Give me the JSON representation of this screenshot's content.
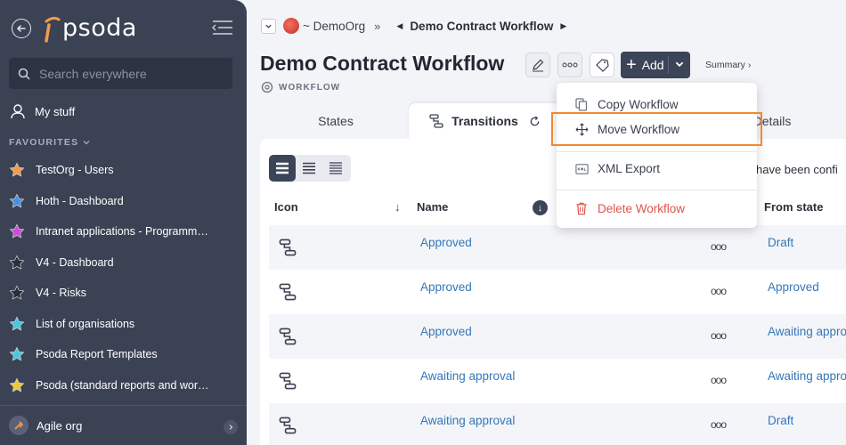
{
  "sidebar": {
    "logo_text": "psoda",
    "search_placeholder": "Search everywhere",
    "my_stuff": "My stuff",
    "favourites_header": "FAVOURITES",
    "favourites": [
      {
        "label": "TestOrg - Users",
        "star_color": "#f39a4c"
      },
      {
        "label": "Hoth - Dashboard",
        "star_color": "#4a90e2"
      },
      {
        "label": "Intranet applications - Programme…",
        "star_color": "#d14ad6"
      },
      {
        "label": "V4 - Dashboard",
        "star_color": "#2a2f3a"
      },
      {
        "label": "V4 - Risks",
        "star_color": "#2a2f3a"
      },
      {
        "label": "List of organisations",
        "star_color": "#4cc7d9"
      },
      {
        "label": "Psoda Report Templates",
        "star_color": "#4cc7d9"
      },
      {
        "label": "Psoda (standard reports and work…",
        "star_color": "#f0c53c"
      }
    ],
    "org_name": "Agile org"
  },
  "breadcrumb": {
    "org": "~ DemoOrg",
    "separator": "»",
    "current": "Demo Contract Workflow"
  },
  "page": {
    "title": "Demo Contract Workflow",
    "subtype": "WORKFLOW",
    "add_label": "Add",
    "summary_label": "Summary ›"
  },
  "tabs": {
    "states": "States",
    "transitions": "Transitions",
    "details": "Details"
  },
  "table": {
    "notice": "have been confi",
    "headers": {
      "icon": "Icon",
      "name": "Name",
      "from_state": "From state"
    },
    "rows": [
      {
        "name": "Approved",
        "from": "Draft"
      },
      {
        "name": "Approved",
        "from": "Approved"
      },
      {
        "name": "Approved",
        "from": "Awaiting appro"
      },
      {
        "name": "Awaiting approval",
        "from": "Awaiting appro"
      },
      {
        "name": "Awaiting approval",
        "from": "Draft"
      }
    ],
    "more_label": "ooo"
  },
  "dropdown": {
    "copy": "Copy Workflow",
    "move": "Move Workflow",
    "xml": "XML Export",
    "delete": "Delete Workflow"
  },
  "colors": {
    "sidebar_bg": "#3b4254",
    "accent_dark": "#3c4457",
    "link": "#3577b8",
    "danger": "#e0544c",
    "highlight": "#f08a2e",
    "logo_orange": "#f39a4c"
  }
}
